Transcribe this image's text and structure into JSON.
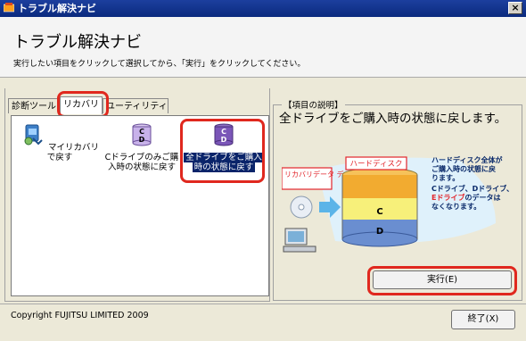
{
  "window": {
    "title": "トラブル解決ナビ",
    "close_label": "×"
  },
  "header": {
    "title": "トラブル解決ナビ",
    "instruction": "実行したい項目をクリックして選択してから、「実行」をクリックしてください。"
  },
  "tabs": [
    {
      "label": "診断ツール"
    },
    {
      "label": "リカバリ"
    },
    {
      "label": "ユーティリティ"
    }
  ],
  "items": [
    {
      "label_line1": "マイリカバリで戻す",
      "label_line2": "",
      "icon": "my-recovery-icon"
    },
    {
      "label_line1": "Cドライブのみご購",
      "label_line2": "入時の状態に戻す",
      "icon": "c-drive-icon"
    },
    {
      "label_line1": "全ドライブをご購入",
      "label_line2": "時の状態に戻す",
      "icon": "all-drives-icon"
    }
  ],
  "description": {
    "legend": "【項目の説明】",
    "heading": "全ドライブをご購入時の状態に戻します。",
    "hard_disk_label": "ハードディスク",
    "recovery_label": "リカバリデータ ディスク",
    "drive_c": "C",
    "drive_d": "D",
    "note_line1": "ハードディスク全体が",
    "note_line2": "ご購入時の状態に戻",
    "note_line3": "ります。",
    "note_line4": "Cドライブ、Dドライブ、",
    "note_line5_red": "Eドライブ",
    "note_line5_rest": "のデータは",
    "note_line6": "なくなります。"
  },
  "buttons": {
    "execute": "実行(E)",
    "exit": "終了(X)"
  },
  "footer": {
    "copyright": "Copyright FUJITSU LIMITED 2009"
  },
  "colors": {
    "highlight_red": "#e0281e",
    "selection": "#0a246a",
    "titlebar": "#0b2a7e"
  }
}
